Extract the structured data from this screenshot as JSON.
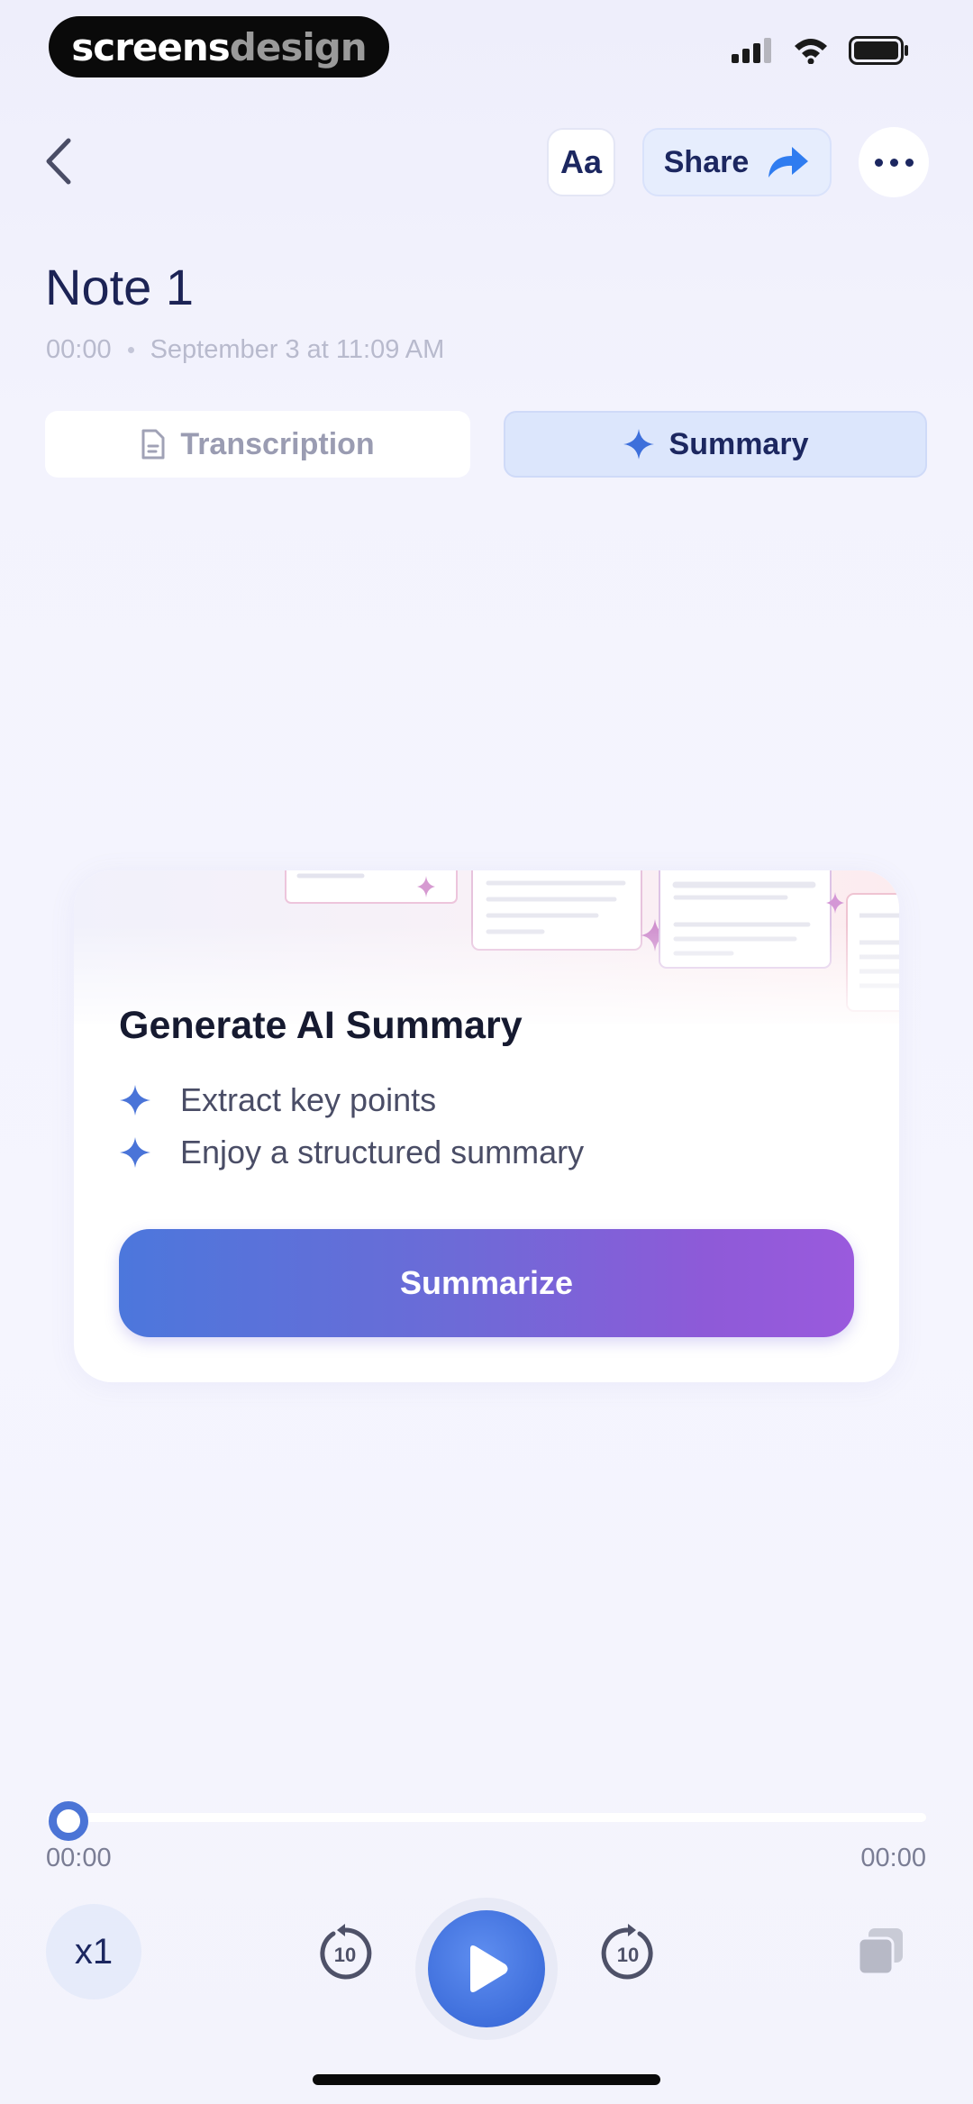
{
  "status_bar": {
    "brand_part1": "screens",
    "brand_part2": "design",
    "icons": [
      "signal-icon",
      "wifi-icon",
      "battery-icon"
    ]
  },
  "header": {
    "back_icon": "chevron-left-icon",
    "font_button": "Aa",
    "share_label": "Share",
    "share_icon": "share-arrow-icon",
    "more_icon": "more-dots-icon"
  },
  "note": {
    "title": "Note 1",
    "duration": "00:00",
    "date": "September 3 at 11:09 AM"
  },
  "tabs": [
    {
      "label": "Transcription",
      "icon": "document-icon",
      "active": false
    },
    {
      "label": "Summary",
      "icon": "sparkle-icon",
      "active": true
    }
  ],
  "summary_card": {
    "title": "Generate AI Summary",
    "bullets": [
      "Extract key points",
      "Enjoy a structured summary"
    ],
    "button_label": "Summarize"
  },
  "player": {
    "progress": 0,
    "current_time": "00:00",
    "total_time": "00:00",
    "speed": "x1",
    "skip_back": "10",
    "skip_forward": "10",
    "icons": [
      "rewind-10-icon",
      "play-icon",
      "forward-10-icon",
      "copy-icon"
    ]
  },
  "colors": {
    "accent": "#4b74d6",
    "purple": "#9a5add",
    "navy": "#1c2760",
    "background": "#f3f3fd"
  }
}
